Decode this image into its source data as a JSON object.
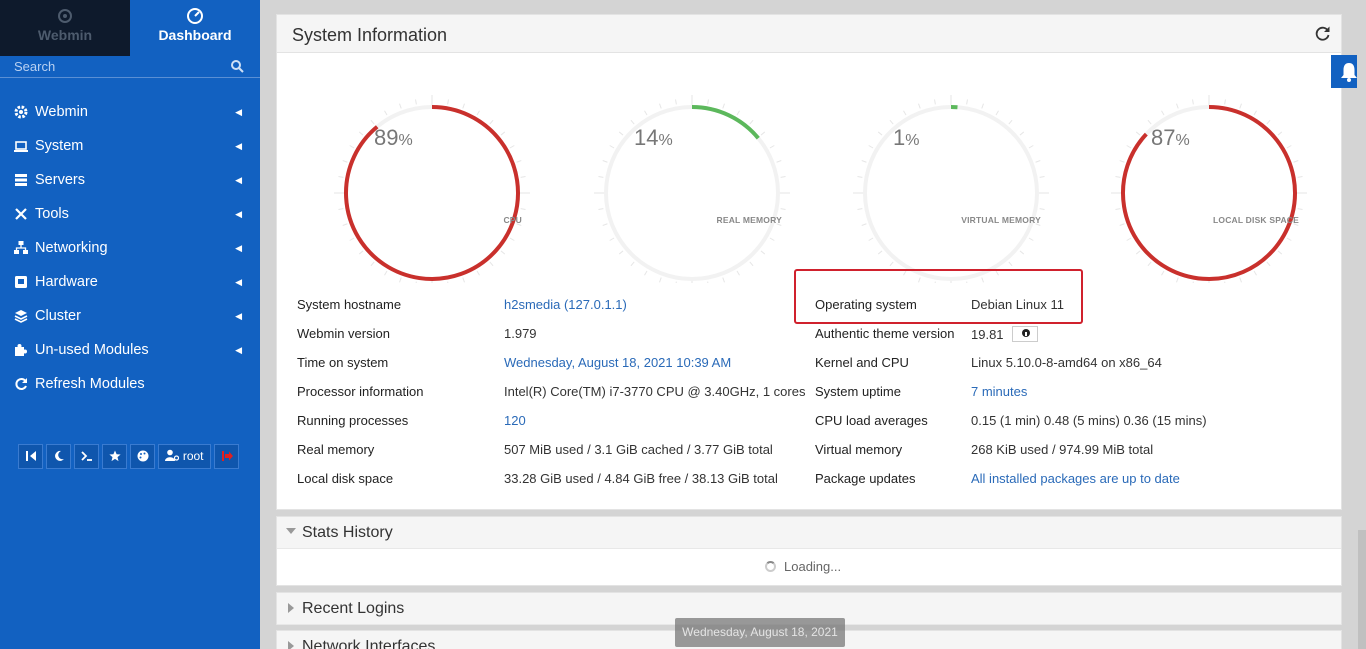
{
  "sidebar": {
    "tabs": {
      "webmin": "Webmin",
      "dashboard": "Dashboard"
    },
    "search_placeholder": "Search",
    "menu": [
      {
        "label": "Webmin",
        "icon": "gear-icon"
      },
      {
        "label": "System",
        "icon": "laptop-icon"
      },
      {
        "label": "Servers",
        "icon": "server-icon"
      },
      {
        "label": "Tools",
        "icon": "tools-icon"
      },
      {
        "label": "Networking",
        "icon": "network-icon"
      },
      {
        "label": "Hardware",
        "icon": "hardware-icon"
      },
      {
        "label": "Cluster",
        "icon": "layers-icon"
      },
      {
        "label": "Un-used Modules",
        "icon": "puzzle-icon"
      },
      {
        "label": "Refresh Modules",
        "icon": "refresh-icon"
      }
    ],
    "toolbar": {
      "user_label": "root"
    }
  },
  "system_info": {
    "title": "System Information",
    "gauges": [
      {
        "key": "cpu",
        "value": "89",
        "unit": "%",
        "label": "CPU",
        "fraction": 0.89,
        "color": "#c9302c"
      },
      {
        "key": "real_memory",
        "value": "14",
        "unit": "%",
        "label": "REAL MEMORY",
        "fraction": 0.14,
        "color": "#5cb85c"
      },
      {
        "key": "virtual_memory",
        "value": "1",
        "unit": "%",
        "label": "VIRTUAL MEMORY",
        "fraction": 0.01,
        "color": "#5cb85c"
      },
      {
        "key": "local_disk",
        "value": "87",
        "unit": "%",
        "label": "LOCAL DISK SPACE",
        "fraction": 0.87,
        "color": "#c9302c"
      }
    ],
    "left_rows": [
      {
        "label": "System hostname",
        "value": "h2smedia (127.0.1.1)",
        "link": true
      },
      {
        "label": "Webmin version",
        "value": "1.979",
        "link": false
      },
      {
        "label": "Time on system",
        "value": "Wednesday, August 18, 2021 10:39 AM",
        "link": true
      },
      {
        "label": "Processor information",
        "value": "Intel(R) Core(TM) i7-3770 CPU @ 3.40GHz, 1 cores",
        "link": false
      },
      {
        "label": "Running processes",
        "value": "120",
        "link": true
      },
      {
        "label": "Real memory",
        "value": "507 MiB used / 3.1 GiB cached / 3.77 GiB total",
        "link": false
      },
      {
        "label": "Local disk space",
        "value": "33.28 GiB used / 4.84 GiB free / 38.13 GiB total",
        "link": false
      }
    ],
    "right_rows": [
      {
        "label": "Operating system",
        "value": "Debian Linux 11",
        "link": false
      },
      {
        "label": "Authentic theme version",
        "value": "19.81",
        "link": false
      },
      {
        "label": "Kernel and CPU",
        "value": "Linux 5.10.0-8-amd64 on x86_64",
        "link": false
      },
      {
        "label": "System uptime",
        "value": "7 minutes",
        "link": true
      },
      {
        "label": "CPU load averages",
        "value": "0.15 (1 min) 0.48 (5 mins) 0.36 (15 mins)",
        "link": false
      },
      {
        "label": "Virtual memory",
        "value": "268 KiB used / 974.99 MiB total",
        "link": false
      },
      {
        "label": "Package updates",
        "value": "All installed packages are up to date",
        "link": true
      }
    ]
  },
  "stats_history": {
    "title": "Stats History",
    "loading": "Loading..."
  },
  "recent_logins": {
    "title": "Recent Logins"
  },
  "network_interfaces": {
    "title": "Network Interfaces"
  },
  "tooltip": {
    "date": "Wednesday, August 18, 2021"
  },
  "colors": {
    "sidebar": "#1261c1",
    "accent_red": "#c9302c",
    "accent_green": "#5cb85c",
    "link": "#2a6ab8"
  }
}
